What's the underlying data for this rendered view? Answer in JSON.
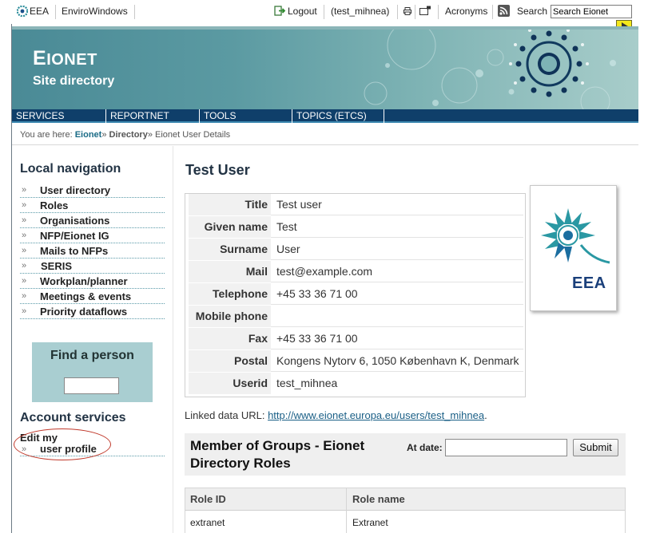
{
  "topbar": {
    "eea": "EEA",
    "envirowindows": "EnviroWindows",
    "logout": "Logout",
    "user": "(test_mihnea)",
    "acronyms": "Acronyms",
    "search_label": "Search",
    "search_value": "Search Eionet"
  },
  "banner": {
    "brand_first": "E",
    "brand_rest": "IONET",
    "subtitle": "Site directory"
  },
  "mainnav": [
    "SERVICES",
    "REPORTNET",
    "TOOLS",
    "TOPICS (ETCS)"
  ],
  "breadcrumb": {
    "prefix": "You are here:",
    "home": "Eionet",
    "directory": "Directory",
    "current": "Eionet User Details",
    "sep": "»"
  },
  "leftnav": {
    "title": "Local navigation",
    "items": [
      "User directory",
      "Roles",
      "Organisations",
      "NFP/Eionet IG",
      "Mails to NFPs",
      "SERIS",
      "Workplan/planner",
      "Meetings & events",
      "Priority dataflows"
    ]
  },
  "find": {
    "title": "Find a person"
  },
  "account": {
    "title": "Account services",
    "edit": "Edit my",
    "profile": "user profile"
  },
  "page": {
    "title": "Test User",
    "fields": [
      {
        "label": "Title",
        "value": "Test user"
      },
      {
        "label": "Given name",
        "value": "Test"
      },
      {
        "label": "Surname",
        "value": "User"
      },
      {
        "label": "Mail",
        "value": "test@example.com"
      },
      {
        "label": "Telephone",
        "value": "+45 33 36 71 00"
      },
      {
        "label": "Mobile phone",
        "value": ""
      },
      {
        "label": "Fax",
        "value": "+45 33 36 71 00"
      },
      {
        "label": "Postal",
        "value": "Kongens Nytorv 6, 1050 København K, Denmark"
      },
      {
        "label": "Userid",
        "value": "test_mihnea"
      }
    ],
    "photo_label": "EEA",
    "linked_prefix": "Linked data URL:",
    "linked_url": "http://www.eionet.europa.eu/users/test_mihnea",
    "linked_suffix": "."
  },
  "groups": {
    "title": "Member of Groups - Eionet Directory Roles",
    "at_date": "At date:",
    "submit": "Submit",
    "columns": [
      "Role ID",
      "Role name"
    ],
    "rows": [
      {
        "id": "extranet",
        "name": "Extranet"
      }
    ]
  },
  "colors": {
    "nav_bg": "#0f3f6a",
    "banner_teal": "#5b9aa2",
    "link": "#1a6b86",
    "find_bg": "#a9ced1",
    "highlight": "#c0392b"
  }
}
